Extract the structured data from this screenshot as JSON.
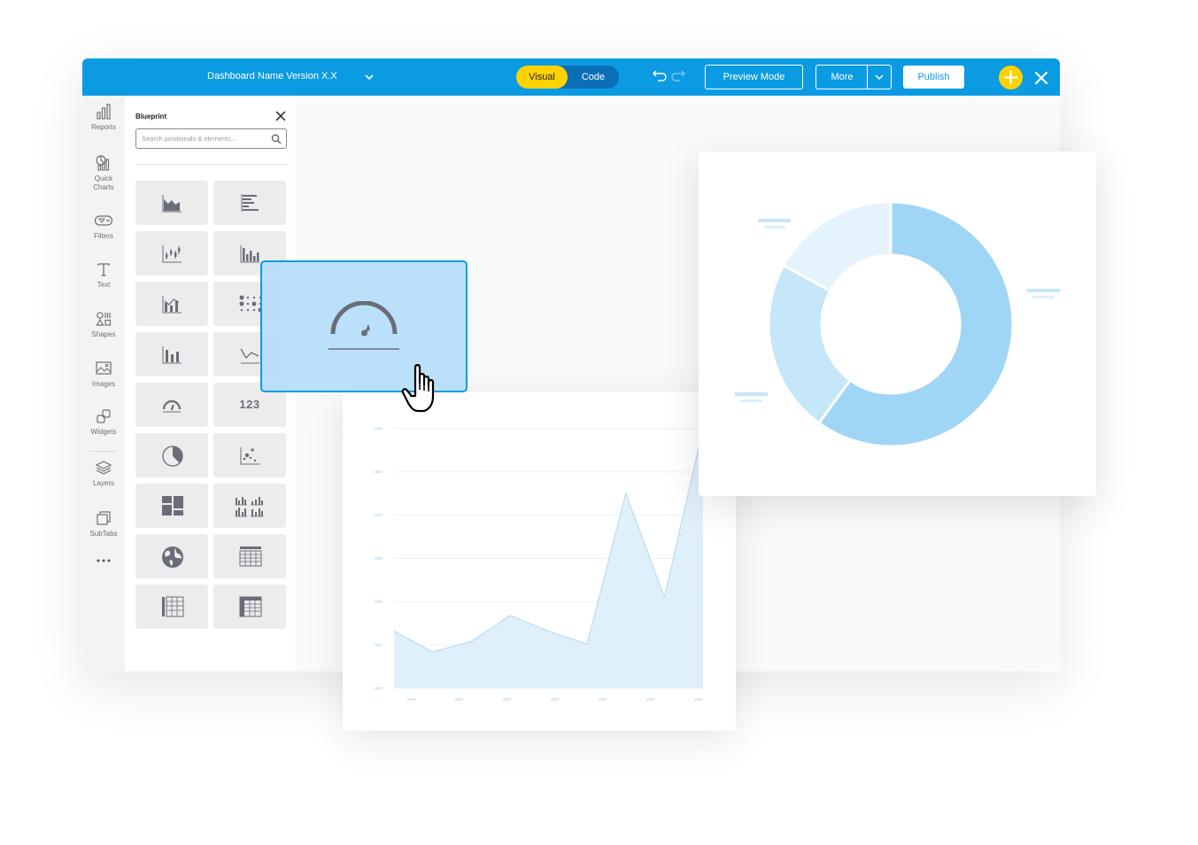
{
  "topbar": {
    "dashboard_title": "Dashboard Name Version X.X",
    "mode_visual": "Visual",
    "mode_code": "Code",
    "preview_label": "Preview Mode",
    "more_label": "More",
    "publish_label": "Publish",
    "accent_color": "#0b9be3",
    "highlight_color": "#ffd200"
  },
  "rail": {
    "items": [
      {
        "label": "Reports",
        "icon": "bar-chart-icon"
      },
      {
        "label": "Quick\nCharts",
        "icon": "quick-charts-icon"
      },
      {
        "label": "Filters",
        "icon": "filter-icon"
      },
      {
        "label": "Text",
        "icon": "text-icon"
      },
      {
        "label": "Shapes",
        "icon": "shapes-icon"
      },
      {
        "label": "Images",
        "icon": "image-icon"
      },
      {
        "label": "Widgets",
        "icon": "widgets-icon"
      },
      {
        "label": "Layers",
        "icon": "layers-icon"
      },
      {
        "label": "SubTabs",
        "icon": "subtabs-icon"
      }
    ],
    "more_icon": "more-dots-icon"
  },
  "panel": {
    "title": "Blueprint",
    "search_placeholder": "Search positionals & elements...",
    "tiles": [
      {
        "icon": "area-chart-icon"
      },
      {
        "icon": "horizontal-bar-chart-icon"
      },
      {
        "icon": "candlestick-chart-icon"
      },
      {
        "icon": "bar-chart-icon"
      },
      {
        "icon": "combo-chart-icon"
      },
      {
        "icon": "dot-matrix-icon"
      },
      {
        "icon": "column-chart-icon"
      },
      {
        "icon": "line-chart-icon"
      },
      {
        "icon": "gauge-icon"
      },
      {
        "icon": "kpi-number-icon",
        "text": "123"
      },
      {
        "icon": "pie-chart-icon"
      },
      {
        "icon": "scatter-chart-icon"
      },
      {
        "icon": "treemap-icon"
      },
      {
        "icon": "small-multiples-icon"
      },
      {
        "icon": "globe-icon"
      },
      {
        "icon": "table-icon"
      },
      {
        "icon": "pivot-table-icon"
      },
      {
        "icon": "data-grid-icon"
      }
    ]
  },
  "chart_data": [
    {
      "type": "area",
      "x": [
        0,
        1,
        2,
        3,
        4,
        5,
        6,
        7,
        8
      ],
      "values": [
        22,
        14,
        18,
        28,
        22,
        17,
        75,
        35,
        100
      ],
      "ylim": [
        0,
        100
      ],
      "grid": true,
      "color": "#d8ecf9"
    },
    {
      "type": "pie",
      "donut": true,
      "values": [
        60,
        23,
        17
      ],
      "colors": [
        "#9fd6f5",
        "#c6e6f9",
        "#e4f3fc"
      ]
    }
  ]
}
